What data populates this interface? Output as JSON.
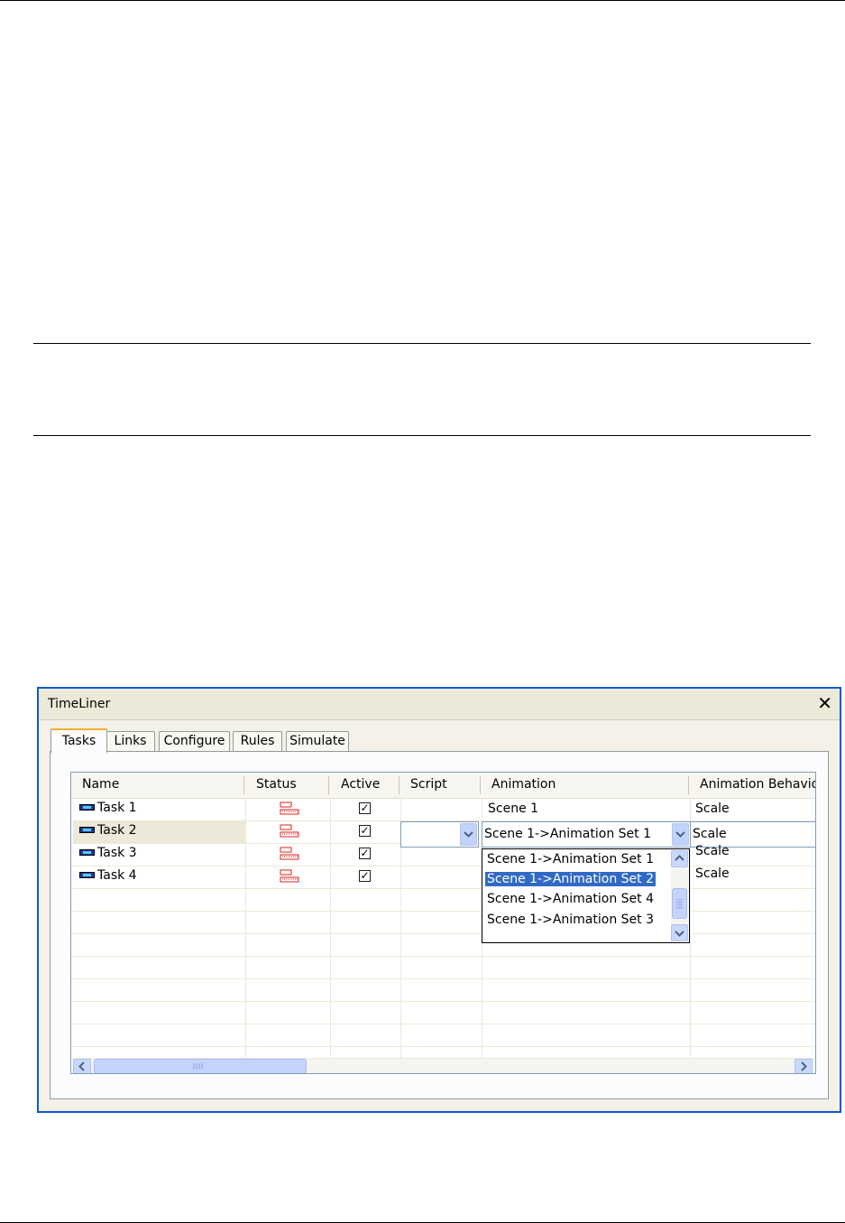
{
  "window": {
    "title": "TimeLiner",
    "close_glyph": "✕"
  },
  "tabs": [
    {
      "label": "Tasks",
      "active": true
    },
    {
      "label": "Links",
      "active": false
    },
    {
      "label": "Configure",
      "active": false
    },
    {
      "label": "Rules",
      "active": false
    },
    {
      "label": "Simulate",
      "active": false
    }
  ],
  "grid": {
    "columns": [
      "Name",
      "Status",
      "Active",
      "Script",
      "Animation",
      "Animation Behaviou"
    ],
    "rows": [
      {
        "name": "Task 1",
        "active": true,
        "animation": "Scene 1",
        "behaviour": "Scale",
        "selected": false
      },
      {
        "name": "Task 2",
        "active": true,
        "animation": "Scene 1->Animation Set 1",
        "behaviour": "Scale",
        "selected": true
      },
      {
        "name": "Task 3",
        "active": true,
        "animation": "",
        "behaviour": "Scale",
        "selected": false
      },
      {
        "name": "Task 4",
        "active": true,
        "animation": "",
        "behaviour": "Scale",
        "selected": false
      }
    ],
    "task_icon": "task-bar-icon",
    "status_icon": "status-bars-icon"
  },
  "animation_dropdown": {
    "options": [
      "Scene 1->Animation Set 1",
      "Scene 1->Animation Set 2",
      "Scene 1->Animation Set 4",
      "Scene 1->Animation Set 3"
    ],
    "highlighted": "Scene 1->Animation Set 2"
  },
  "colors": {
    "window_border": "#0a58d4",
    "selection": "#316ac5",
    "status_icon": "#e0201c",
    "task_icon": "#1b3fa0"
  }
}
